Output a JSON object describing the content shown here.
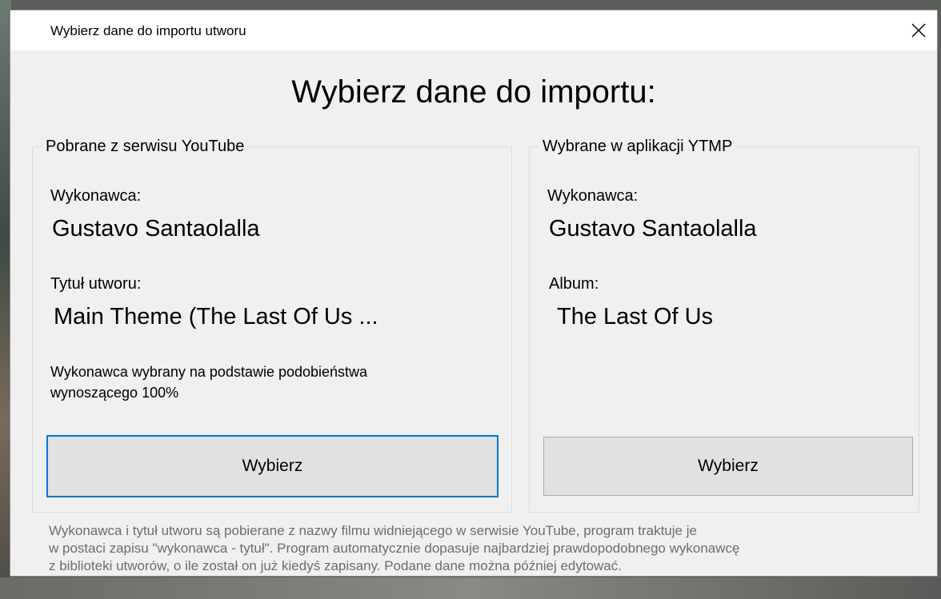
{
  "window": {
    "title": "Wybierz dane do importu utworu",
    "close_glyph": "✕"
  },
  "heading": "Wybierz dane do importu:",
  "left_group": {
    "legend": "Pobrane z serwisu YouTube",
    "artist_label": "Wykonawca:",
    "artist_value": "Gustavo Santaolalla",
    "title_label": "Tytuł utworu:",
    "title_value": "Main Theme (The Last Of Us ...",
    "note_line1": "Wykonawca wybrany na podstawie podobieństwa",
    "note_line2": "wynoszącego 100%",
    "button_label": "Wybierz"
  },
  "right_group": {
    "legend": "Wybrane w aplikacji YTMP",
    "artist_label": "Wykonawca:",
    "artist_value": "Gustavo Santaolalla",
    "album_label": "Album:",
    "album_value": "The Last Of Us",
    "button_label": "Wybierz"
  },
  "footer": {
    "line1": "Wykonawca i tytuł utworu są pobierane z nazwy filmu widniejącego w serwisie YouTube, program traktuje je",
    "line2": "w postaci zapisu \"wykonawca - tytuł\". Program automatycznie dopasuje najbardziej prawdopodobnego wykonawcę",
    "line3": "z biblioteki utworów, o ile został on już kiedyś zapisany. Podane dane można później edytować."
  },
  "colors": {
    "focus_border": "#0078d7",
    "dialog_bg": "#f0f0f0",
    "footer_text": "#6d6d6d"
  }
}
